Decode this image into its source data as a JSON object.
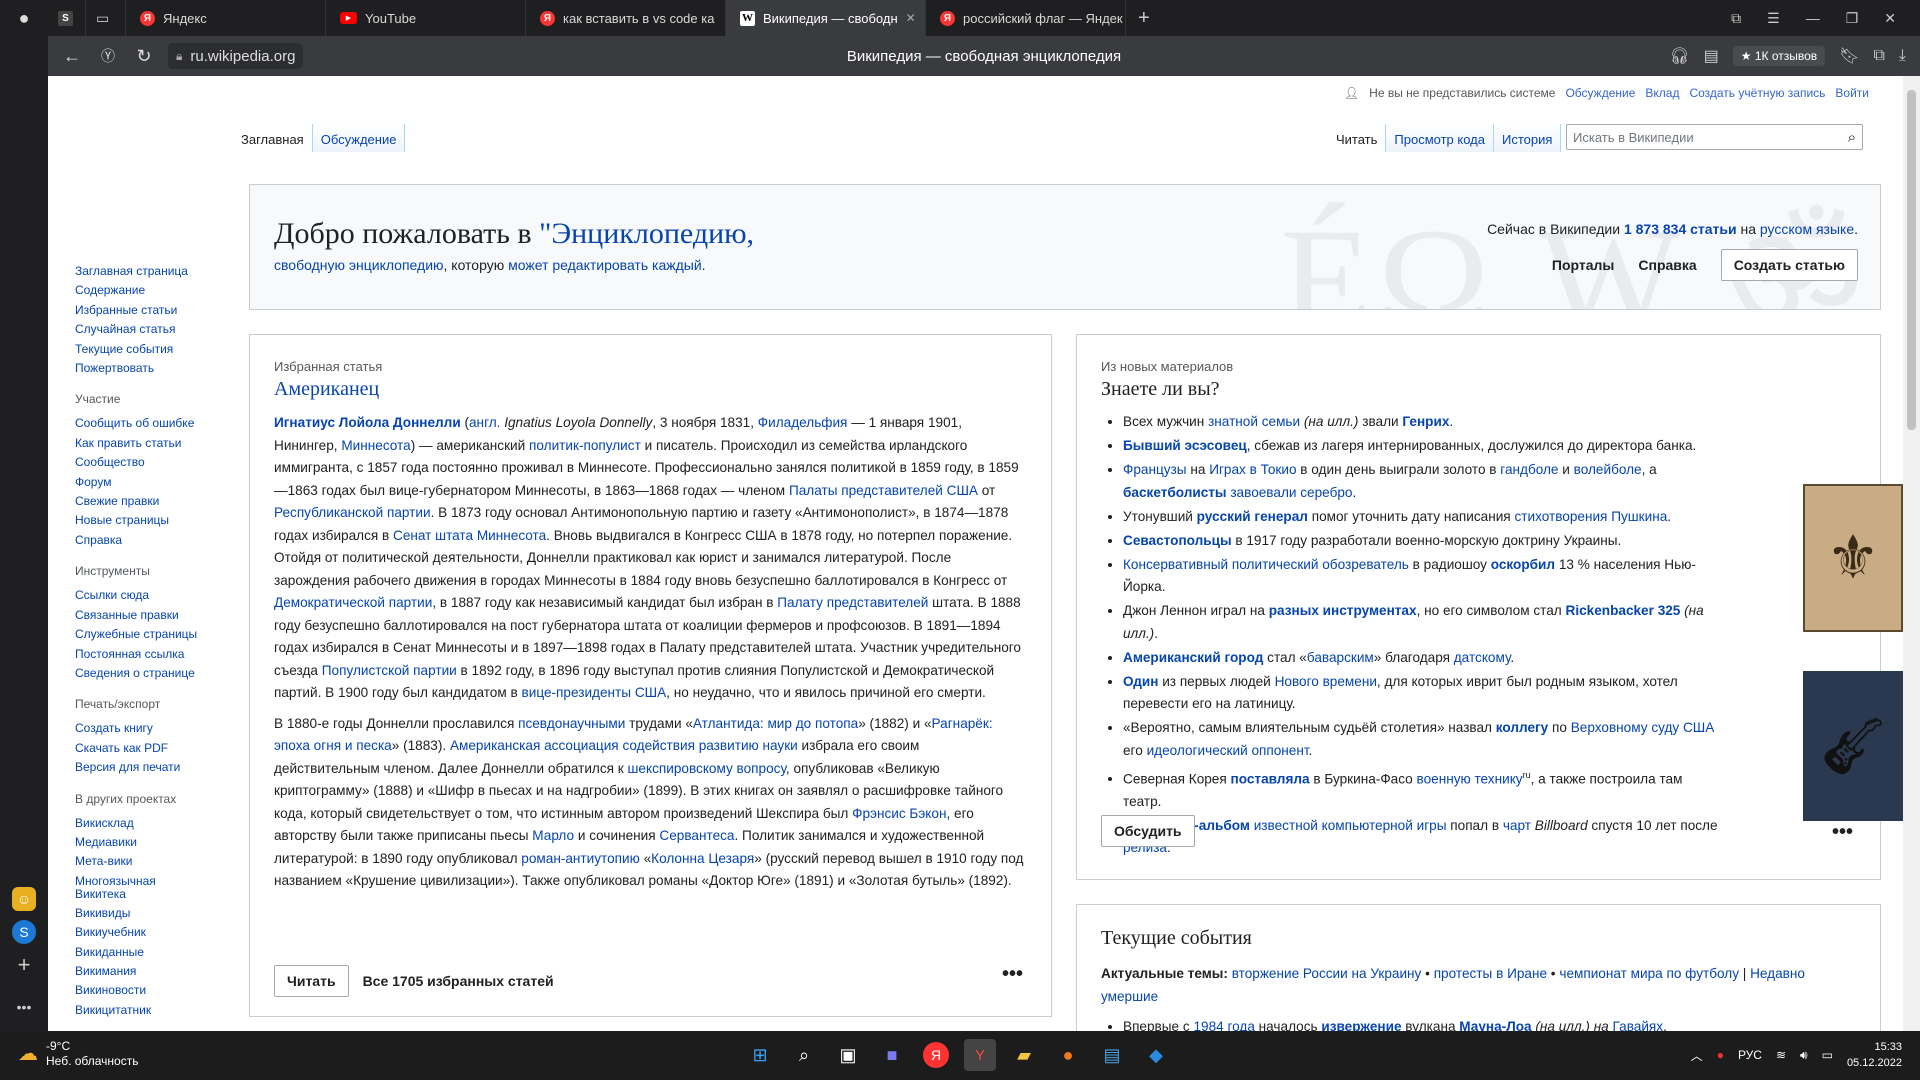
{
  "browser": {
    "tabs": [
      {
        "label": "Яндекс",
        "icon": "yandex-icon"
      },
      {
        "label": "YouTube",
        "icon": "youtube-icon"
      },
      {
        "label": "как вставить в vs code ка",
        "icon": "yandex-icon"
      },
      {
        "label": "Википедия — свободн",
        "icon": "wikipedia-icon",
        "active": true
      },
      {
        "label": "российский флаг — Яндек",
        "icon": "yandex-icon"
      }
    ],
    "url": "ru.wikipedia.org",
    "page_title": "Википедия — свободная энциклопедия",
    "reviews": "★ 1К отзывов"
  },
  "wiki": {
    "user_menu": {
      "not_logged": "Не вы не представились системе",
      "talk": "Обсуждение",
      "contrib": "Вклад",
      "create_account": "Создать учётную запись",
      "login": "Войти"
    },
    "tabs_left": [
      "Заглавная",
      "Обсуждение"
    ],
    "tabs_right": [
      "Читать",
      "Просмотр кода",
      "История"
    ],
    "search_placeholder": "Искать в Википедии",
    "sidebar": {
      "nav": [
        "Заглавная страница",
        "Содержание",
        "Избранные статьи",
        "Случайная статья",
        "Текущие события",
        "Пожертвовать"
      ],
      "participation_h": "Участие",
      "participation": [
        "Сообщить об ошибке",
        "Как править статьи",
        "Сообщество",
        "Форум",
        "Свежие правки",
        "Новые страницы",
        "Справка"
      ],
      "tools_h": "Инструменты",
      "tools": [
        "Ссылки сюда",
        "Связанные правки",
        "Служебные страницы",
        "Постоянная ссылка",
        "Сведения о странице"
      ],
      "print_h": "Печать/экспорт",
      "print": [
        "Создать книгу",
        "Скачать как PDF",
        "Версия для печати"
      ],
      "projects_h": "В других проектах",
      "projects": [
        "Викисклад",
        "Медиавики",
        "Мета-вики",
        "Многоязычная Викитека",
        "Викивиды",
        "Викиучебник",
        "Викиданные",
        "Викимания",
        "Викиновости",
        "Викицитатник"
      ]
    },
    "welcome": {
      "title_plain": "Добро пожаловать в ",
      "title_link": "\"Энциклопедию,",
      "sub_link1": "свободную энциклопедию",
      "sub_text": ", которую ",
      "sub_link2": "может редактировать каждый",
      "sub_end": ".",
      "stat_text": "Сейчас в Википедии ",
      "stat_count": "1 873 834 статьи",
      "stat_on": " на ",
      "stat_lang": "русском языке",
      "stat_end": ".",
      "portals": "Порталы",
      "help": "Справка",
      "create": "Создать статью",
      "watermark": "ÉΩ W ॐ"
    },
    "featured": {
      "heading": "Избранная статья",
      "title": "Американец",
      "read_btn": "Читать",
      "all_link": "Все 1705 избранных статей"
    },
    "dyk": {
      "heading": "Из новых материалов",
      "title": "Знаете ли вы?",
      "discuss_btn": "Обсудить"
    },
    "current": {
      "title": "Текущие события",
      "topics_label": "Актуальные темы:",
      "topics": [
        "вторжение России на Украину",
        "протесты в Иране",
        "чемпионат мира по футболу",
        "Недавно умершие"
      ],
      "item_pre": "Впервые с ",
      "item_year": "1984 года",
      "item_mid": " началось ",
      "item_erupt": "извержение",
      "item_vulcan": " вулкана ",
      "item_mauna": "Мауна-Лоа",
      "item_ill": " (на илл.) на ",
      "item_hawaii": "Гавайях",
      "item_end": "."
    }
  },
  "taskbar": {
    "temp": "-9°C",
    "weather": "Неб. облачность",
    "lang": "РУС",
    "time": "15:33",
    "date": "05.12.2022"
  }
}
